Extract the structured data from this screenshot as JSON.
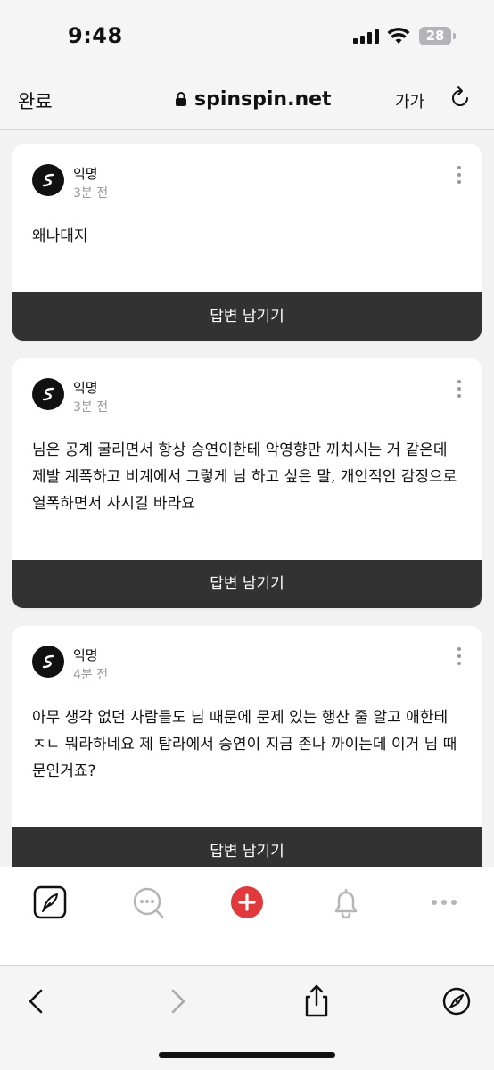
{
  "status_bar": {
    "time": "9:48",
    "battery": "28"
  },
  "browser": {
    "done_label": "완료",
    "url": "spinspin.net",
    "text_size_label": "가가"
  },
  "posts": [
    {
      "author": "익명",
      "time": "3분 전",
      "content": "왜나대지",
      "reply_label": "답변 남기기"
    },
    {
      "author": "익명",
      "time": "3분 전",
      "content": "님은 공계 굴리면서 항상 승연이한테 악영향만 끼치시는 거 같은데 제발 계폭하고 비계에서 그렇게 님 하고 싶은 말, 개인적인 감정으로 열폭하면서 사시길 바라요",
      "reply_label": "답변 남기기"
    },
    {
      "author": "익명",
      "time": "4분 전",
      "content": "아무 생각 없던 사람들도 님 때문에 문제 있는 행산 줄 알고 애한테 ㅈㄴ 뭐라하네요 제 탐라에서 승연이 지금 존나 까이는데 이거 님 때문인거죠?",
      "reply_label": "답변 남기기"
    }
  ],
  "app_nav": {
    "items": [
      "pen-icon",
      "chat-search-icon",
      "add-icon",
      "bell-icon",
      "more-horizontal-icon"
    ],
    "accent_color": "#e03a3e"
  },
  "safari_toolbar": {
    "items": [
      "back-icon",
      "forward-icon",
      "share-icon",
      "compass-icon"
    ]
  }
}
